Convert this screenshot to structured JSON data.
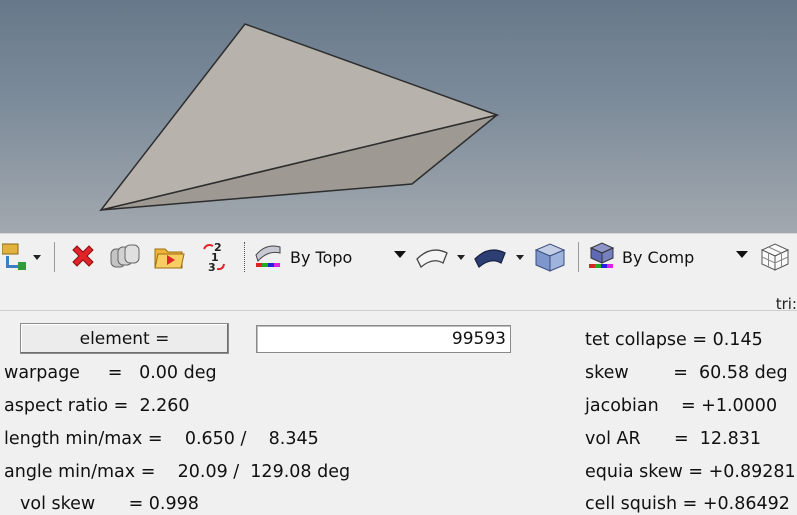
{
  "toolbar": {
    "topo_combo": "By Topo",
    "comp_combo": "By Comp"
  },
  "tabstrip": {
    "tab_label": "tri:"
  },
  "panel": {
    "element_button": "element =",
    "element_id": "99593",
    "left_stats": [
      "warpage     =   0.00 deg",
      "aspect ratio =  2.260",
      "length min/max =    0.650 /    8.345",
      "angle min/max =    20.09 /  129.08 deg",
      "vol skew      = 0.998"
    ],
    "right_stats": [
      "tet collapse = 0.145",
      "skew        =  60.58 deg",
      "jacobian    = +1.0000",
      "vol AR      =  12.831",
      "equia skew = +0.89281",
      "cell squish = +0.86492"
    ]
  }
}
